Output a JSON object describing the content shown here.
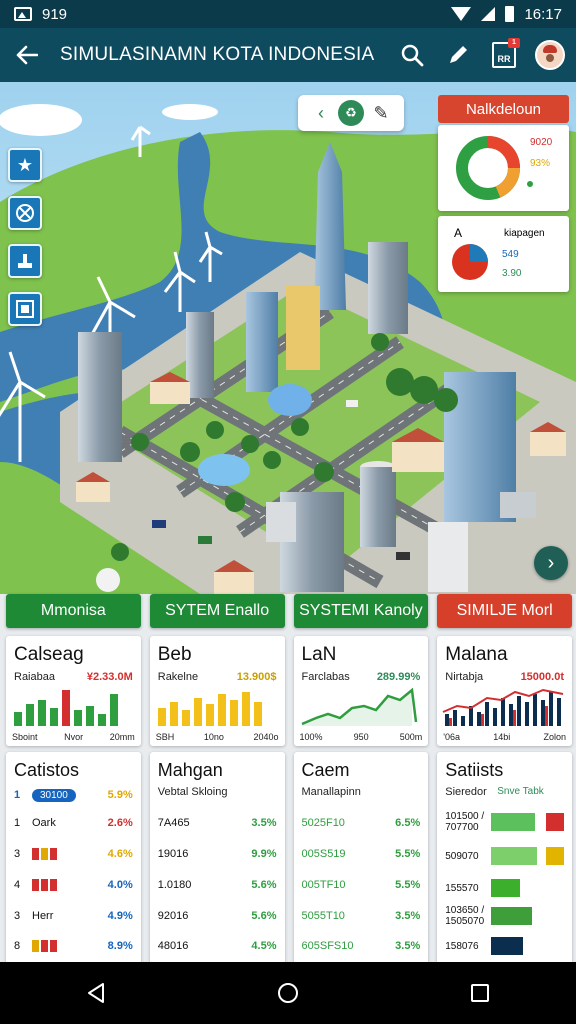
{
  "status_bar": {
    "left_text": "919",
    "time": "16:17"
  },
  "app_bar": {
    "title": "SIMULASINAMN KOTA INDONESIA",
    "report_label": "RR",
    "report_badge": "1"
  },
  "map": {
    "panel_title": "Nalkdeloun",
    "widget1": {
      "value1": "9020",
      "value2": "93%"
    },
    "widget2": {
      "letter": "A",
      "label": "kiapagen",
      "value1": "549",
      "value2": "3.90"
    }
  },
  "tabs": [
    {
      "label": "Mmonisa",
      "color": "green"
    },
    {
      "label": "SYTEM Enallo",
      "color": "green"
    },
    {
      "label": "SYSTEMI Kanoly",
      "color": "green"
    },
    {
      "label": "SIMILJE Morl",
      "color": "red"
    }
  ],
  "stat_cards": [
    {
      "title": "Calseag",
      "subtitle": "Raiabaa",
      "value": "¥2.33.0M",
      "value_color": "#d32f2f",
      "ticks": [
        "Sboint",
        "Nvor",
        "20mm"
      ]
    },
    {
      "title": "Beb",
      "subtitle": "Rakelne",
      "value": "13.900$",
      "value_color": "#e0a800",
      "ticks": [
        "SBH",
        "10no",
        "2040o"
      ]
    },
    {
      "title": "LaN",
      "subtitle": "Farclabas",
      "value": "289.99%",
      "value_color": "#2e8b57",
      "ticks": [
        "100%",
        "950",
        "500m"
      ]
    },
    {
      "title": "Malana",
      "subtitle": "Nirtabja",
      "value": "15000.0t",
      "value_color": "#d32f2f",
      "ticks": [
        "'06a",
        "14bi",
        "Zolon"
      ]
    }
  ],
  "lists": [
    {
      "title": "Catistos",
      "rows": [
        {
          "key": "1",
          "name": "",
          "pill": "30100",
          "value": "5.9%",
          "value_color": "#e0a800"
        },
        {
          "key": "1",
          "name": "Oark",
          "value": "2.6%",
          "value_color": "#d32f2f"
        },
        {
          "key": "3",
          "name": "",
          "chips": [
            "#d32f2f",
            "#e0a800",
            "#d32f2f"
          ],
          "value": "4.6%",
          "value_color": "#e0a800"
        },
        {
          "key": "4",
          "name": "",
          "chips": [
            "#d32f2f",
            "#d32f2f",
            "#d32f2f"
          ],
          "value": "4.0%",
          "value_color": "#1565c0"
        },
        {
          "key": "3",
          "name": "Herr",
          "value": "4.9%",
          "value_color": "#1565c0"
        },
        {
          "key": "8",
          "name": "",
          "chips": [
            "#e0a800",
            "#d32f2f",
            "#d32f2f"
          ],
          "value": "8.9%",
          "value_color": "#1565c0"
        }
      ]
    },
    {
      "title": "Mahgan",
      "subtitle": "Vebtal Skloing",
      "rows": [
        {
          "name": "7A465",
          "value": "3.5%"
        },
        {
          "name": "19016",
          "value": "9.9%"
        },
        {
          "name": "1.0180",
          "value": "5.6%"
        },
        {
          "name": "92016",
          "value": "5.6%"
        },
        {
          "name": "48016",
          "value": "4.5%"
        }
      ]
    },
    {
      "title": "Caem",
      "subtitle": "Manallapinn",
      "rows": [
        {
          "name": "5025F10",
          "value": "6.5%"
        },
        {
          "name": "005S519",
          "value": "5.5%"
        },
        {
          "name": "005TF10",
          "value": "5.5%"
        },
        {
          "name": "5055T10",
          "value": "3.5%"
        },
        {
          "name": "605SFS10",
          "value": "3.5%"
        }
      ]
    },
    {
      "title": "Satiists",
      "subtitle": "Sieredor",
      "subtitle2": "Snve Tabk",
      "rows": [
        {
          "name": "101500 / 707700",
          "bar": 0.75,
          "bar_color": "#5cc05c",
          "flag_color": "#d32f2f"
        },
        {
          "name": "509070",
          "bar": 0.78,
          "bar_color": "#7ccf6a",
          "flag_color": "#e0b400"
        },
        {
          "name": "155570",
          "bar": 0.5,
          "bar_color": "#3cb02c",
          "flag_color": ""
        },
        {
          "name": "103650 / 1505070",
          "bar": 0.7,
          "bar_color": "#3e9e3a",
          "flag_color": ""
        },
        {
          "name": "158076",
          "bar": 0.55,
          "bar_color": "#0b2e4f",
          "flag_color": ""
        }
      ]
    }
  ]
}
